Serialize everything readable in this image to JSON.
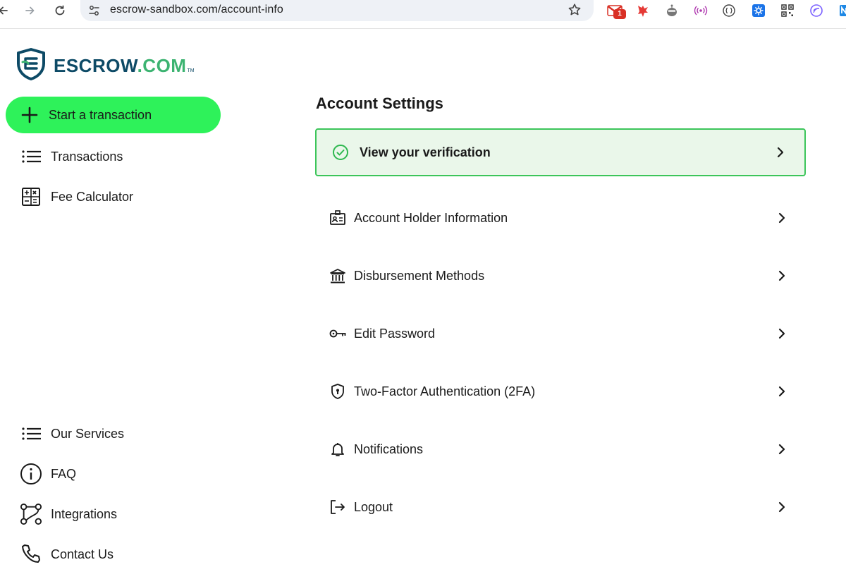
{
  "browser": {
    "url": "escrow-sandbox.com/account-info",
    "mail_badge": "1"
  },
  "brand": {
    "name_part1": "ESCROW",
    "name_part2": ".COM",
    "tm": "TM",
    "primary_color": "#0d4a66",
    "accent_color": "#3cb371"
  },
  "sidebar": {
    "start_label": "Start a transaction",
    "start_color": "#2ef25a",
    "top_items": [
      {
        "label": "Transactions",
        "icon": "list-icon"
      },
      {
        "label": "Fee Calculator",
        "icon": "calculator-icon"
      }
    ],
    "bottom_items": [
      {
        "label": "Our Services",
        "icon": "list-icon"
      },
      {
        "label": "FAQ",
        "icon": "info-icon"
      },
      {
        "label": "Integrations",
        "icon": "integrations-icon"
      },
      {
        "label": "Contact Us",
        "icon": "phone-icon"
      }
    ]
  },
  "main": {
    "title": "Account Settings",
    "verification": {
      "label": "View your verification",
      "icon": "check-circle-icon"
    },
    "items": [
      {
        "label": "Account Holder Information",
        "icon": "id-card-icon"
      },
      {
        "label": "Disbursement Methods",
        "icon": "bank-icon"
      },
      {
        "label": "Edit Password",
        "icon": "key-icon"
      },
      {
        "label": "Two-Factor Authentication (2FA)",
        "icon": "shield-lock-icon"
      },
      {
        "label": "Notifications",
        "icon": "bell-icon"
      },
      {
        "label": "Logout",
        "icon": "logout-icon"
      }
    ]
  }
}
